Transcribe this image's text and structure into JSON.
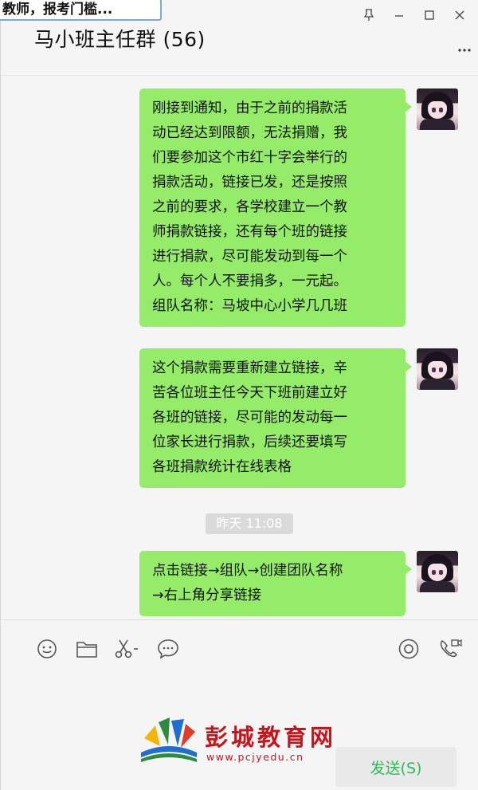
{
  "tooltip": {
    "text": "教师，报考门槛..."
  },
  "header": {
    "title": "马小班主任群 (56)",
    "more_label": "·· ·"
  },
  "messages": [
    {
      "lines": [
        "刚接到通知，由于之前的捐款活",
        "动已经达到限额，无法捐赠，我",
        "们要参加这个市红十字会举行的",
        "捐款活动，链接已发，还是按照",
        "之前的要求，各学校建立一个教",
        "师捐款链接，还有每个班的链接",
        "进行捐款，尽可能发动到每一个",
        "人。每个人不要捐多，一元起。",
        "组队名称：马坡中心小学几几班"
      ]
    },
    {
      "lines": [
        "这个捐款需要重新建立链接，辛",
        "苦各位班主任今天下班前建立好",
        "各班的链接，尽可能的发动每一",
        "位家长进行捐款，后续还要填写",
        "各班捐款统计在线表格"
      ]
    },
    {
      "lines": [
        "点击链接→组队→创建团队名称",
        "→右上角分享链接"
      ]
    }
  ],
  "time_separator": "昨天 11:08",
  "toolbar": {
    "icons": [
      "emoji-icon",
      "folder-icon",
      "scissors-icon",
      "chat-bubble-icon",
      "live-icon",
      "video-call-icon"
    ]
  },
  "watermark": {
    "name": "彭城教育网",
    "url": "www.pcjyedu.cn"
  },
  "send": {
    "label": "发送(S)"
  },
  "colors": {
    "bubble": "#95ec69",
    "send_text": "#2dbb55",
    "watermark": "#c4161c"
  }
}
